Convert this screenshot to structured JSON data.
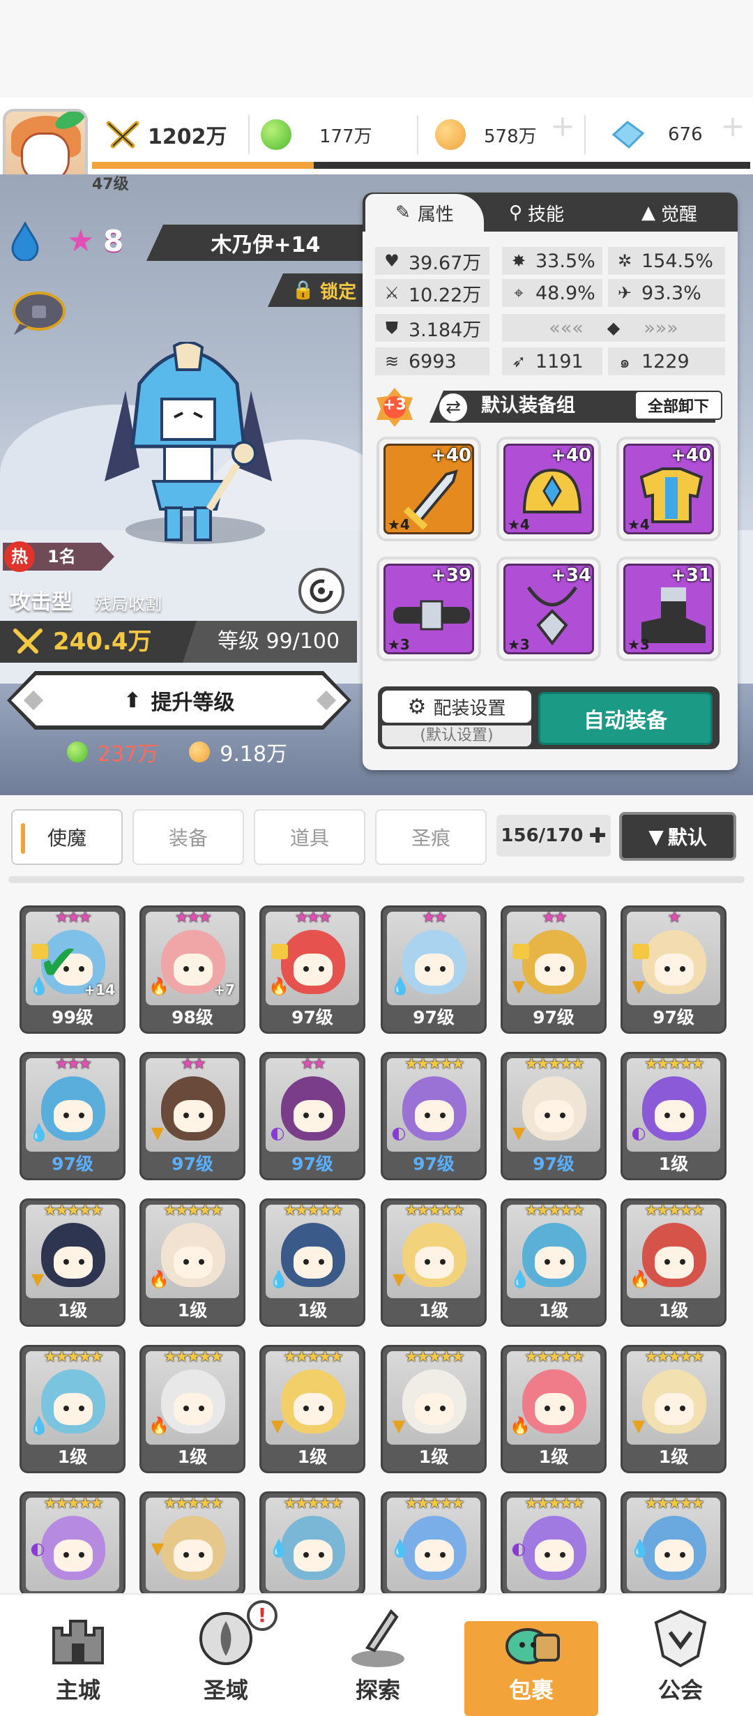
{
  "player": {
    "level": "47级",
    "power": "1202万",
    "green_currency": "177万",
    "gold_currency": "578万",
    "diamond_currency": "676"
  },
  "hero": {
    "star_count": "8",
    "name": "木乃伊+14",
    "lock_label": "锁定",
    "heat_label": "热",
    "rank": "1名",
    "type": "攻击型",
    "role": "残局收割",
    "power": "240.4万",
    "level": "等级 99/100",
    "upgrade_label": "提升等级",
    "cost_green": "237万",
    "cost_gold": "9.18万"
  },
  "panel": {
    "tabs": [
      {
        "label": "属性",
        "icon": "attribute-icon"
      },
      {
        "label": "技能",
        "icon": "skill-icon"
      },
      {
        "label": "觉醒",
        "icon": "awaken-icon"
      }
    ],
    "stats": [
      {
        "icon": "heart-icon",
        "value": "39.67万"
      },
      {
        "icon": "burst-icon",
        "value": "33.5%"
      },
      {
        "icon": "gear-burst-icon",
        "value": "154.5%"
      },
      {
        "icon": "sword-icon",
        "value": "10.22万"
      },
      {
        "icon": "crosshair-icon",
        "value": "48.9%"
      },
      {
        "icon": "dodge-icon",
        "value": "93.3%"
      },
      {
        "icon": "shield-icon",
        "value": "3.184万"
      },
      {
        "icon": "wind-icon",
        "value": "6993"
      },
      {
        "icon": "pierce-icon",
        "value": "1191"
      },
      {
        "icon": "swirl-icon",
        "value": "1229"
      }
    ],
    "equip_plus": "+3",
    "equip_set": "默认装备组",
    "unload_all": "全部卸下",
    "equipment": [
      {
        "name": "sword",
        "plus": "+40",
        "stars": "★4"
      },
      {
        "name": "helmet",
        "plus": "+40",
        "stars": "★4"
      },
      {
        "name": "armor",
        "plus": "+40",
        "stars": "★4"
      },
      {
        "name": "belt",
        "plus": "+39",
        "stars": "★3"
      },
      {
        "name": "necklace",
        "plus": "+34",
        "stars": "★3"
      },
      {
        "name": "boots",
        "plus": "+31",
        "stars": "★3"
      }
    ],
    "config_label": "配装设置",
    "config_default": "(默认设置)",
    "auto_equip": "自动装备"
  },
  "categories": [
    "使魔",
    "装备",
    "道具",
    "圣痕"
  ],
  "inventory_count": "156/170",
  "sort_label": "默认",
  "cards": [
    {
      "stars": "★★★",
      "level": "99级",
      "blue": false,
      "elem": "water",
      "lock": true,
      "plus": "+14",
      "check": true,
      "color": "#7fc0e8"
    },
    {
      "stars": "★★★",
      "level": "98级",
      "blue": false,
      "elem": "fire",
      "lock": false,
      "plus": "+7",
      "check": false,
      "color": "#f0a6a6"
    },
    {
      "stars": "★★★",
      "level": "97级",
      "blue": false,
      "elem": "fire",
      "lock": true,
      "plus": "",
      "check": false,
      "color": "#e6534f"
    },
    {
      "stars": "★★",
      "level": "97级",
      "blue": false,
      "elem": "water",
      "lock": false,
      "plus": "",
      "check": false,
      "color": "#a9d3ee"
    },
    {
      "stars": "★★",
      "level": "97级",
      "blue": false,
      "elem": "earth",
      "lock": true,
      "plus": "",
      "check": false,
      "color": "#e6b545"
    },
    {
      "stars": "★",
      "level": "97级",
      "blue": false,
      "elem": "earth",
      "lock": true,
      "plus": "",
      "check": false,
      "color": "#f3ddb0"
    },
    {
      "stars": "★★★",
      "level": "97级",
      "blue": true,
      "elem": "water",
      "lock": false,
      "plus": "",
      "check": false,
      "color": "#5aaedc"
    },
    {
      "stars": "★★",
      "level": "97级",
      "blue": true,
      "elem": "earth",
      "lock": false,
      "plus": "",
      "check": false,
      "color": "#6a4a3a"
    },
    {
      "stars": "★★",
      "level": "97级",
      "blue": true,
      "elem": "dark",
      "lock": false,
      "plus": "",
      "check": false,
      "color": "#7a3d8a"
    },
    {
      "stars": "★★★★★",
      "level": "97级",
      "blue": true,
      "elem": "dark",
      "lock": false,
      "plus": "",
      "check": false,
      "color": "#9a72d6"
    },
    {
      "stars": "★★★★★",
      "level": "97级",
      "blue": true,
      "elem": "earth",
      "lock": false,
      "plus": "",
      "check": false,
      "color": "#f1e6d6"
    },
    {
      "stars": "★★★★★",
      "level": "1级",
      "blue": false,
      "elem": "dark",
      "lock": false,
      "plus": "",
      "check": false,
      "color": "#8a5ad8"
    },
    {
      "stars": "★★★★★",
      "level": "1级",
      "blue": false,
      "elem": "earth",
      "lock": false,
      "plus": "",
      "check": false,
      "color": "#2e3550"
    },
    {
      "stars": "★★★★★",
      "level": "1级",
      "blue": false,
      "elem": "fire",
      "lock": false,
      "plus": "",
      "check": false,
      "color": "#f1e2d2"
    },
    {
      "stars": "★★★★★",
      "level": "1级",
      "blue": false,
      "elem": "water",
      "lock": false,
      "plus": "",
      "check": false,
      "color": "#3a5a8a"
    },
    {
      "stars": "★★★★★",
      "level": "1级",
      "blue": false,
      "elem": "earth",
      "lock": false,
      "plus": "",
      "check": false,
      "color": "#f2d27a"
    },
    {
      "stars": "★★★★★",
      "level": "1级",
      "blue": false,
      "elem": "water",
      "lock": false,
      "plus": "",
      "check": false,
      "color": "#5ab0d6"
    },
    {
      "stars": "★★★★★",
      "level": "1级",
      "blue": false,
      "elem": "fire",
      "lock": false,
      "plus": "",
      "check": false,
      "color": "#d6534a"
    },
    {
      "stars": "★★★★★",
      "level": "1级",
      "blue": false,
      "elem": "water",
      "lock": false,
      "plus": "",
      "check": false,
      "color": "#7ac4e0"
    },
    {
      "stars": "★★★★★",
      "level": "1级",
      "blue": false,
      "elem": "fire",
      "lock": false,
      "plus": "",
      "check": false,
      "color": "#e8e8e8"
    },
    {
      "stars": "★★★★★",
      "level": "1级",
      "blue": false,
      "elem": "earth",
      "lock": false,
      "plus": "",
      "check": false,
      "color": "#f3cf6a"
    },
    {
      "stars": "★★★★★",
      "level": "1级",
      "blue": false,
      "elem": "earth",
      "lock": false,
      "plus": "",
      "check": false,
      "color": "#f0ede6"
    },
    {
      "stars": "★★★★★",
      "level": "1级",
      "blue": false,
      "elem": "fire",
      "lock": false,
      "plus": "",
      "check": false,
      "color": "#f07c8a"
    },
    {
      "stars": "★★★★★",
      "level": "1级",
      "blue": false,
      "elem": "earth",
      "lock": false,
      "plus": "",
      "check": false,
      "color": "#f3e0b0"
    },
    {
      "stars": "★★★★★",
      "level": "",
      "blue": false,
      "elem": "dark",
      "lock": false,
      "plus": "",
      "check": false,
      "color": "#b58ae0"
    },
    {
      "stars": "★★★★★",
      "level": "",
      "blue": false,
      "elem": "earth",
      "lock": false,
      "plus": "",
      "check": false,
      "color": "#e6c88a"
    },
    {
      "stars": "★★★★★",
      "level": "",
      "blue": false,
      "elem": "water",
      "lock": false,
      "plus": "",
      "check": false,
      "color": "#7ab6d6"
    },
    {
      "stars": "★★★★★",
      "level": "",
      "blue": false,
      "elem": "water",
      "lock": false,
      "plus": "",
      "check": false,
      "color": "#7aaee8"
    },
    {
      "stars": "★★★★★",
      "level": "",
      "blue": false,
      "elem": "dark",
      "lock": false,
      "plus": "",
      "check": false,
      "color": "#a07ae0"
    },
    {
      "stars": "★★★★★",
      "level": "",
      "blue": false,
      "elem": "water",
      "lock": false,
      "plus": "",
      "check": false,
      "color": "#6aa8e0"
    }
  ],
  "nav": [
    {
      "label": "主城",
      "icon": "castle-icon"
    },
    {
      "label": "圣域",
      "icon": "portal-icon"
    },
    {
      "label": "探索",
      "icon": "explore-sword-icon"
    },
    {
      "label": "包裹",
      "icon": "bag-icon"
    },
    {
      "label": "公会",
      "icon": "guild-icon"
    }
  ],
  "nav_badge": "!",
  "colors": {
    "accent": "#f2a33a",
    "teal": "#1b9a86",
    "dark": "#3b3b3b"
  }
}
